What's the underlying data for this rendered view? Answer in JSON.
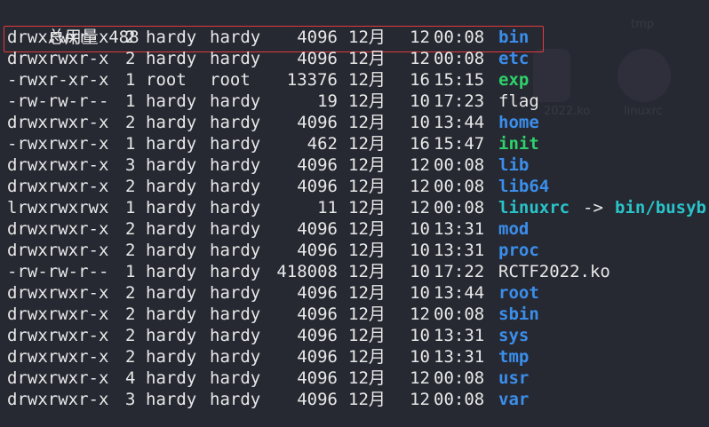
{
  "summary": {
    "label": "总用量",
    "value": "488"
  },
  "colors": {
    "background": "#262832",
    "directory": "#3b8eea",
    "executable": "#2ed16a",
    "symlink": "#2ac3c8",
    "plain": "#e8e8e8",
    "highlight": "#e23b3b"
  },
  "ghost_desktop": {
    "labels": [
      "tmp",
      "2022.ko",
      "linuxrc"
    ]
  },
  "entries": [
    {
      "perm": "drwxrwxr-x",
      "links": "2",
      "owner": "hardy",
      "group": "hardy",
      "size": "4096",
      "month": "12月",
      "day": "12",
      "time": "00:08",
      "name": "bin",
      "kind": "dir",
      "highlighted": true
    },
    {
      "perm": "drwxrwxr-x",
      "links": "2",
      "owner": "hardy",
      "group": "hardy",
      "size": "4096",
      "month": "12月",
      "day": "12",
      "time": "00:08",
      "name": "etc",
      "kind": "dir"
    },
    {
      "perm": "-rwxr-xr-x",
      "links": "1",
      "owner": "root",
      "group": "root",
      "size": "13376",
      "month": "12月",
      "day": "16",
      "time": "15:15",
      "name": "exp",
      "kind": "exec"
    },
    {
      "perm": "-rw-rw-r--",
      "links": "1",
      "owner": "hardy",
      "group": "hardy",
      "size": "19",
      "month": "12月",
      "day": "10",
      "time": "17:23",
      "name": "flag",
      "kind": "file"
    },
    {
      "perm": "drwxrwxr-x",
      "links": "2",
      "owner": "hardy",
      "group": "hardy",
      "size": "4096",
      "month": "12月",
      "day": "10",
      "time": "13:44",
      "name": "home",
      "kind": "dir"
    },
    {
      "perm": "-rwxrwxr-x",
      "links": "1",
      "owner": "hardy",
      "group": "hardy",
      "size": "462",
      "month": "12月",
      "day": "16",
      "time": "15:47",
      "name": "init",
      "kind": "exec"
    },
    {
      "perm": "drwxrwxr-x",
      "links": "3",
      "owner": "hardy",
      "group": "hardy",
      "size": "4096",
      "month": "12月",
      "day": "12",
      "time": "00:08",
      "name": "lib",
      "kind": "dir"
    },
    {
      "perm": "drwxrwxr-x",
      "links": "2",
      "owner": "hardy",
      "group": "hardy",
      "size": "4096",
      "month": "12月",
      "day": "12",
      "time": "00:08",
      "name": "lib64",
      "kind": "dir"
    },
    {
      "perm": "lrwxrwxrwx",
      "links": "1",
      "owner": "hardy",
      "group": "hardy",
      "size": "11",
      "month": "12月",
      "day": "12",
      "time": "00:08",
      "name": "linuxrc",
      "kind": "link",
      "arrow": "->",
      "target": "bin/busyb"
    },
    {
      "perm": "drwxrwxr-x",
      "links": "2",
      "owner": "hardy",
      "group": "hardy",
      "size": "4096",
      "month": "12月",
      "day": "10",
      "time": "13:31",
      "name": "mod",
      "kind": "dir"
    },
    {
      "perm": "drwxrwxr-x",
      "links": "2",
      "owner": "hardy",
      "group": "hardy",
      "size": "4096",
      "month": "12月",
      "day": "10",
      "time": "13:31",
      "name": "proc",
      "kind": "dir"
    },
    {
      "perm": "-rw-rw-r--",
      "links": "1",
      "owner": "hardy",
      "group": "hardy",
      "size": "418008",
      "month": "12月",
      "day": "10",
      "time": "17:22",
      "name": "RCTF2022.ko",
      "kind": "file"
    },
    {
      "perm": "drwxrwxr-x",
      "links": "2",
      "owner": "hardy",
      "group": "hardy",
      "size": "4096",
      "month": "12月",
      "day": "10",
      "time": "13:44",
      "name": "root",
      "kind": "dir"
    },
    {
      "perm": "drwxrwxr-x",
      "links": "2",
      "owner": "hardy",
      "group": "hardy",
      "size": "4096",
      "month": "12月",
      "day": "12",
      "time": "00:08",
      "name": "sbin",
      "kind": "dir"
    },
    {
      "perm": "drwxrwxr-x",
      "links": "2",
      "owner": "hardy",
      "group": "hardy",
      "size": "4096",
      "month": "12月",
      "day": "10",
      "time": "13:31",
      "name": "sys",
      "kind": "dir"
    },
    {
      "perm": "drwxrwxr-x",
      "links": "2",
      "owner": "hardy",
      "group": "hardy",
      "size": "4096",
      "month": "12月",
      "day": "10",
      "time": "13:31",
      "name": "tmp",
      "kind": "dir"
    },
    {
      "perm": "drwxrwxr-x",
      "links": "4",
      "owner": "hardy",
      "group": "hardy",
      "size": "4096",
      "month": "12月",
      "day": "12",
      "time": "00:08",
      "name": "usr",
      "kind": "dir"
    },
    {
      "perm": "drwxrwxr-x",
      "links": "3",
      "owner": "hardy",
      "group": "hardy",
      "size": "4096",
      "month": "12月",
      "day": "12",
      "time": "00:08",
      "name": "var",
      "kind": "dir"
    }
  ]
}
